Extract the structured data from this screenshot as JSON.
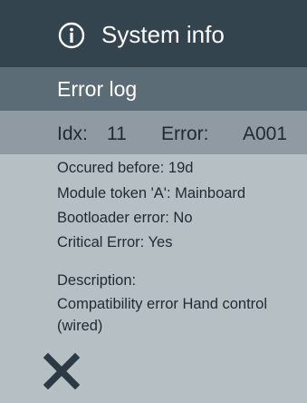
{
  "header": {
    "icon": "info-icon",
    "title": "System info",
    "background": "#34444f"
  },
  "subheader": {
    "title": "Error log",
    "background": "#5c6c77"
  },
  "entry": {
    "idx_label": "Idx:",
    "idx_value": "11",
    "error_label": "Error:",
    "error_value": "A001",
    "background": "#8f9aa2"
  },
  "details": {
    "occurred": "Occured before: 19d",
    "module_token": "Module token 'A': Mainboard",
    "bootloader": "Bootloader error: No",
    "critical": "Critical Error: Yes",
    "description_label": "Description:",
    "description_line1": "Compatibility error Hand control",
    "description_line2": "(wired)"
  },
  "footer": {
    "close_icon": "close-icon"
  },
  "colors": {
    "content_background": "#b6bfc4",
    "text_dark": "#1f2a31",
    "text_light": "#ffffff"
  }
}
